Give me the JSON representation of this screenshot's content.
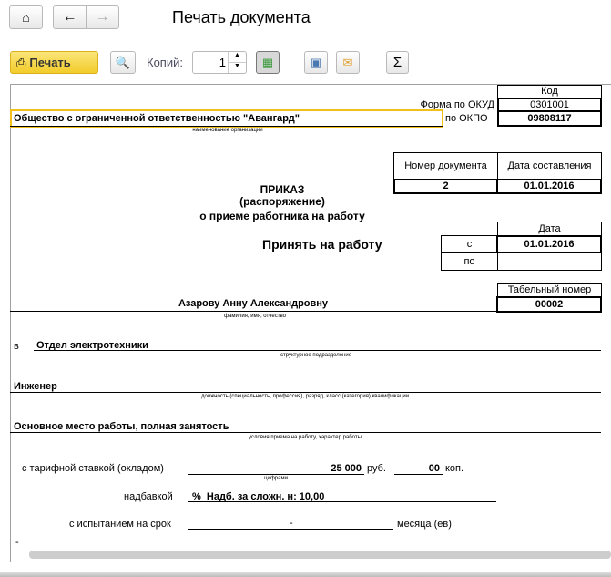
{
  "header": {
    "title": "Печать документа",
    "home_icon": "home-icon",
    "back_icon": "arrow-left-icon",
    "forward_icon": "arrow-right-icon"
  },
  "toolbar": {
    "print_label": "Печать",
    "copies_label": "Копий:",
    "copies_value": "1",
    "accent": "#f5d33a"
  },
  "doc": {
    "okud_label": "Форма по ОКУД",
    "okpo_label": "по ОКПО",
    "code_header": "Код",
    "okud_value": "0301001",
    "okpo_value": "09808117",
    "org_name": "Общество с ограниченной ответственностью \"Авангард\"",
    "org_caption": "наименование организации",
    "docnum_header": "Номер документа",
    "date_header": "Дата составления",
    "docnum_value": "2",
    "date_value": "01.01.2016",
    "title1": "ПРИКАЗ",
    "title2": "(распоряжение)",
    "title3": "о приеме работника на работу",
    "hire_label": "Принять на работу",
    "period_header": "Дата",
    "from_label": "с",
    "to_label": "по",
    "from_value": "01.01.2016",
    "to_value": "",
    "tab_header": "Табельный номер",
    "tab_value": "00002",
    "employee": "Азарову Анну Александровну",
    "employee_caption": "фамилия, имя, отчество",
    "in_label": "в",
    "department": "Отдел электротехники",
    "department_caption": "структурное подразделение",
    "position": "Инженер",
    "position_caption": "должность (специальность, профессия), разряд, класс (категория) квалификации",
    "conditions": "Основное место работы, полная занятость",
    "conditions_caption": "условия приема на работу, характер работы",
    "rate_label": "с тарифной ставкой (окладом)",
    "rate_value": "25 000",
    "rub_label": "руб.",
    "kop_value": "00",
    "kop_label": "коп.",
    "rate_caption": "цифрами",
    "bonus_label": "надбавкой",
    "bonus_value": "%  Надб. за сложн. н: 10,00",
    "probation_label": "с испытанием на срок",
    "probation_value": "-",
    "months_label": "месяца (ев)",
    "trailing": "-"
  }
}
